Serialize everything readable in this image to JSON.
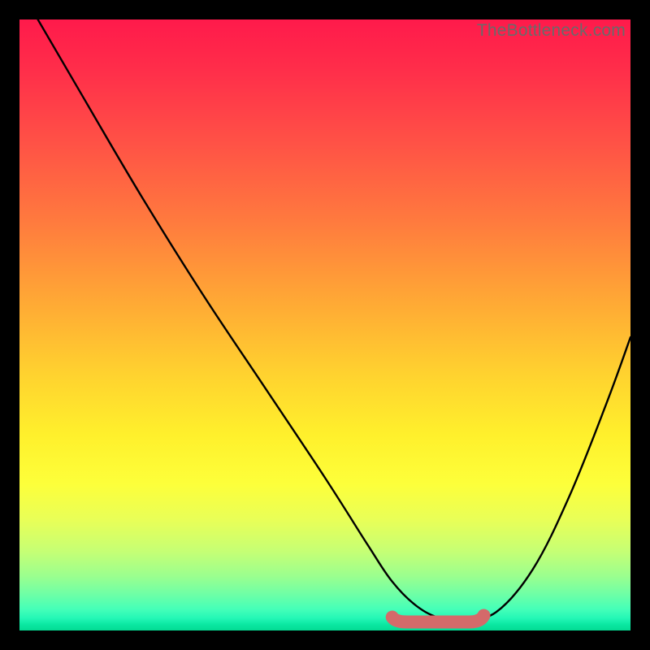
{
  "watermark": "TheBottleneck.com",
  "colors": {
    "frame": "#000000",
    "curve": "#000000",
    "highlight_fill": "#d46a6a",
    "highlight_stroke": "#c94f4f"
  },
  "chart_data": {
    "type": "line",
    "title": "",
    "xlabel": "",
    "ylabel": "",
    "xlim": [
      0,
      100
    ],
    "ylim": [
      0,
      100
    ],
    "grid": false,
    "legend": false,
    "series": [
      {
        "name": "bottleneck-curve",
        "x": [
          3,
          10,
          20,
          30,
          40,
          50,
          57,
          61,
          65,
          69,
          73,
          78,
          84,
          90,
          96,
          100
        ],
        "y": [
          100,
          88,
          71,
          55,
          40,
          25,
          14,
          8,
          4,
          2,
          2,
          3,
          10,
          22,
          37,
          48
        ]
      }
    ],
    "annotations": [
      {
        "name": "sweet-spot",
        "shape": "rounded-segment",
        "x_range": [
          61,
          76
        ],
        "y": 2.2
      }
    ],
    "background_gradient": {
      "direction": "vertical",
      "stops": [
        {
          "pos": 0.0,
          "color": "#ff1a4b"
        },
        {
          "pos": 0.5,
          "color": "#ffc032"
        },
        {
          "pos": 0.78,
          "color": "#fbff3c"
        },
        {
          "pos": 1.0,
          "color": "#03db93"
        }
      ]
    }
  }
}
